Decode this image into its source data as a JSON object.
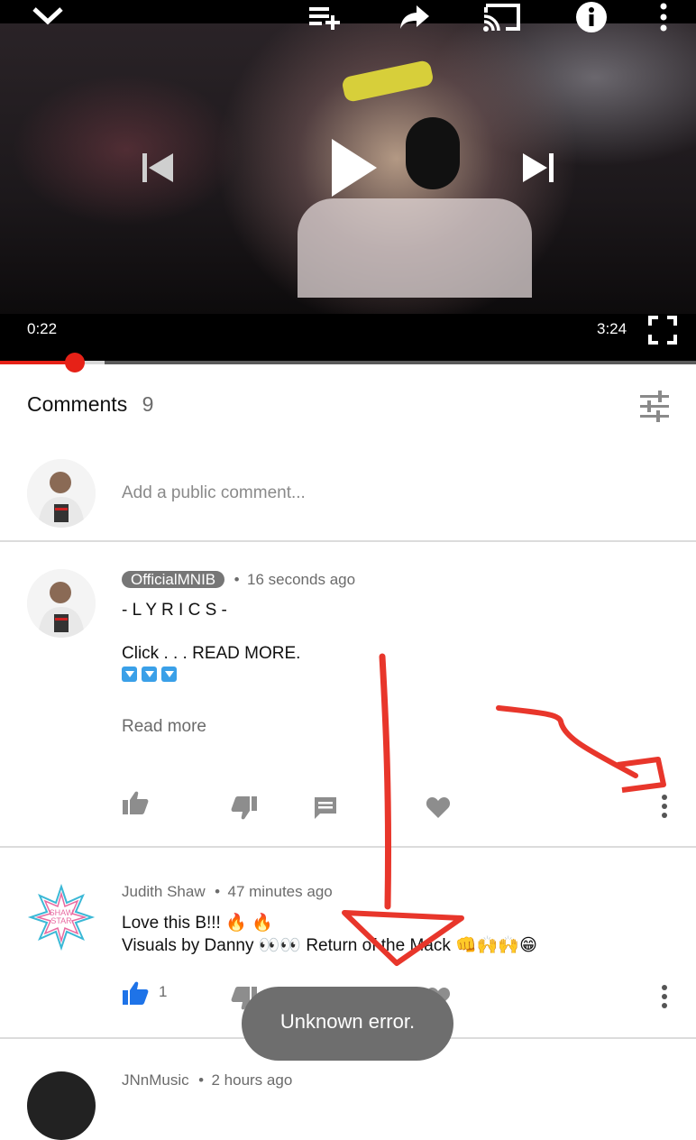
{
  "player": {
    "current_time": "0:22",
    "duration": "3:24",
    "progress_fraction": 0.108,
    "buffer_fraction": 0.15,
    "icons": [
      "collapse-chevron-icon",
      "add-to-playlist-icon",
      "share-icon",
      "cast-icon",
      "info-icon",
      "more-vert-icon",
      "previous-icon",
      "play-icon",
      "next-icon",
      "fullscreen-icon"
    ]
  },
  "comments_header": {
    "title": "Comments",
    "count": "9"
  },
  "add_comment": {
    "placeholder": "Add a public comment..."
  },
  "comments": [
    {
      "author": "OfficialMNIB",
      "time": "16 seconds ago",
      "line1": "- L Y R I C S -",
      "line2": "Click . . . READ MORE.",
      "read_more": "Read more",
      "likes": ""
    },
    {
      "author": "Judith Shaw",
      "time": "47 minutes ago",
      "line1": "Love this B!!! 🔥 🔥",
      "line2": "Visuals by Danny 👀👀 Return of the Mack 👊🙌🙌😁",
      "likes": "1",
      "avatar_text": "SHAW STAR"
    },
    {
      "author": "JNnMusic",
      "time": "2 hours ago"
    }
  ],
  "toast": {
    "message": "Unknown error."
  },
  "colors": {
    "accent": "#e62117",
    "like_active": "#1e73e8",
    "annotation": "#e8362b"
  }
}
